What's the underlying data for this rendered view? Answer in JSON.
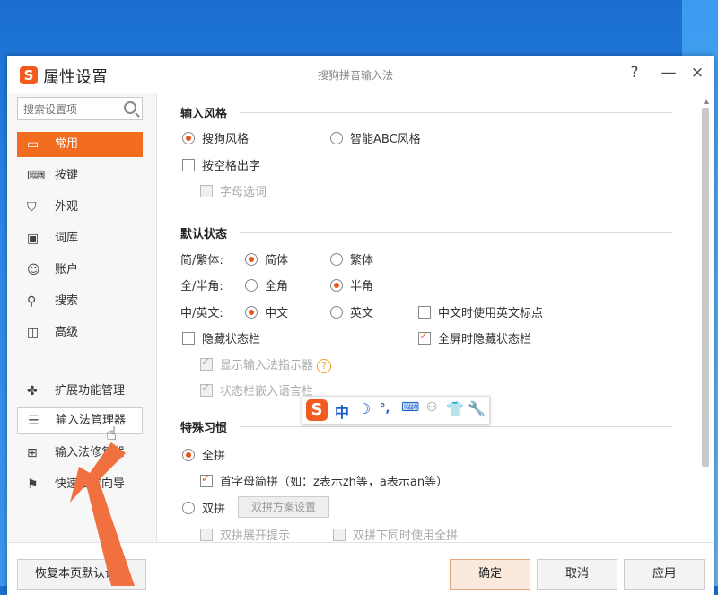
{
  "dialog": {
    "title": "属性设置",
    "subtitle": "搜狗拼音输入法",
    "help_label": "?",
    "minimize_label": "—",
    "close_label": "×",
    "logo_letter": "S"
  },
  "sidebar": {
    "search_placeholder": "搜索设置项",
    "items": [
      {
        "label": "常用",
        "icon": "monitor-icon"
      },
      {
        "label": "按键",
        "icon": "keyboard-icon"
      },
      {
        "label": "外观",
        "icon": "shirt-icon"
      },
      {
        "label": "词库",
        "icon": "book-icon"
      },
      {
        "label": "账户",
        "icon": "user-icon"
      },
      {
        "label": "搜索",
        "icon": "search-icon"
      },
      {
        "label": "高级",
        "icon": "window-icon"
      }
    ],
    "extra": [
      {
        "label": "扩展功能管理",
        "icon": "puzzle-icon"
      },
      {
        "label": "输入法管理器",
        "icon": "list-icon"
      },
      {
        "label": "输入法修复器",
        "icon": "toolbox-icon"
      },
      {
        "label": "快速设置向导",
        "icon": "flag-icon"
      }
    ],
    "restore_label": "恢复本页默认设置"
  },
  "input_style": {
    "title": "输入风格",
    "sogou_style": "搜狗风格",
    "abc_style": "智能ABC风格",
    "space_output": "按空格出字",
    "letter_select": "字母选词"
  },
  "default_state": {
    "title": "默认状态",
    "simp_trad_label": "简/繁体:",
    "simplified": "简体",
    "traditional": "繁体",
    "width_label": "全/半角:",
    "full_width": "全角",
    "half_width": "半角",
    "lang_label": "中/英文:",
    "chinese": "中文",
    "english": "英文",
    "cn_en_punct": "中文时使用英文标点",
    "hide_status": "隐藏状态栏",
    "fullscreen_hide": "全屏时隐藏状态栏",
    "show_indicator": "显示输入法指示器",
    "embed_lang_bar": "状态栏嵌入语言栏"
  },
  "habits": {
    "title": "特殊习惯",
    "quanpin": "全拼",
    "initial_abbr": "首字母简拼（如：z表示zh等，a表示an等）",
    "shuangpin": "双拼",
    "shuangpin_settings": "双拼方案设置",
    "shuangpin_hint": "双拼展开提示",
    "shuangpin_with_quanpin": "双拼下同时使用全拼"
  },
  "statusbar": {
    "logo": "S",
    "lang": "中",
    "moon": "☽",
    "punct": "°,"
  },
  "footer": {
    "ok": "确定",
    "cancel": "取消",
    "apply": "应用"
  },
  "colors": {
    "accent": "#f26c1f",
    "arrow": "#f07040"
  }
}
